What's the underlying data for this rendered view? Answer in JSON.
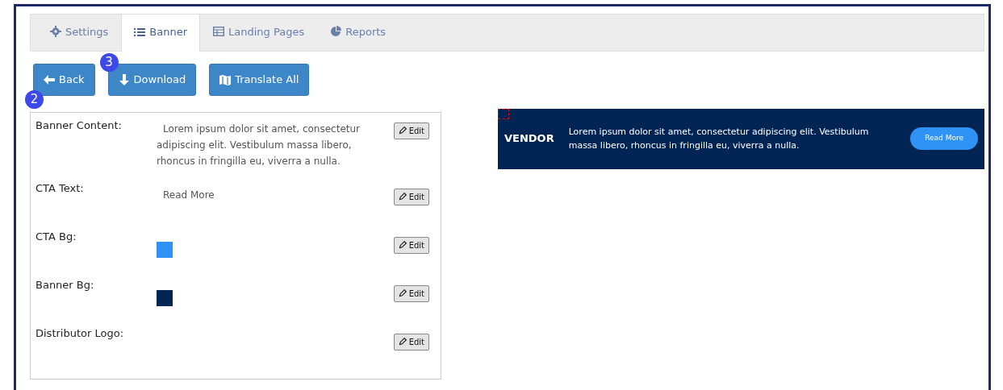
{
  "tabs": [
    {
      "label": "Settings",
      "selected": false
    },
    {
      "label": "Banner",
      "selected": true
    },
    {
      "label": "Landing Pages",
      "selected": false
    },
    {
      "label": "Reports",
      "selected": false
    }
  ],
  "buttons": [
    {
      "label": "Back",
      "step": "2"
    },
    {
      "label": "Download",
      "step": "3"
    },
    {
      "label": "Translate All"
    }
  ],
  "fields": [
    {
      "label": "Banner Content:",
      "kind": "text",
      "value": "Lorem ipsum dolor sit amet, consectetur adipiscing elit. Vestibulum massa libero, rhoncus in fringilla eu, viverra a nulla.",
      "edit": "Edit"
    },
    {
      "label": "CTA Text:",
      "kind": "text",
      "value": "Read More",
      "edit": "Edit"
    },
    {
      "label": "CTA Bg:",
      "kind": "color",
      "color": "#2f93f5",
      "edit": "Edit"
    },
    {
      "label": "Banner Bg:",
      "kind": "color",
      "color": "#002454",
      "edit": "Edit"
    },
    {
      "label": "Distributor Logo:",
      "kind": "empty",
      "edit": "Edit"
    }
  ],
  "banner": {
    "logo": "VENDOR",
    "text": "Lorem ipsum dolor sit amet, consectetur adipiscing elit. Vestibulum massa libero, rhoncus in fringilla eu, viverra a nulla.",
    "cta": "Read More"
  }
}
